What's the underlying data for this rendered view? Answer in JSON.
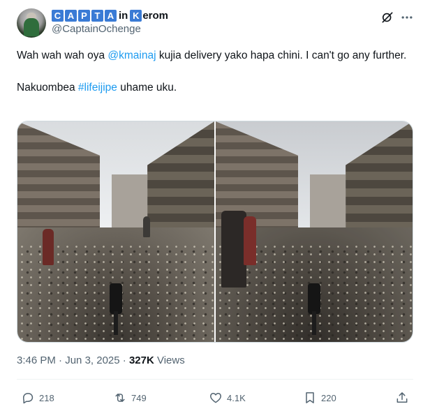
{
  "author": {
    "name_boxed": [
      "C",
      "A",
      "P",
      "T",
      "A"
    ],
    "name_in": "in",
    "name_k": "K",
    "name_rest": "erom",
    "handle": "@CaptainOchenge"
  },
  "tweet": {
    "line1_pre": "Wah wah wah oya ",
    "mention": "@kmainaj",
    "line1_post": " kujia delivery yako hapa chini. I can't go any further.",
    "line2_pre": "Nakuombea ",
    "hashtag": "#lifeijipe",
    "line2_post": " uhame uku."
  },
  "meta": {
    "time": "3:46 PM",
    "sep1": " · ",
    "date": "Jun 3, 2025",
    "sep2": " · ",
    "views_count": "327K",
    "views_label": " Views"
  },
  "actions": {
    "replies": "218",
    "reposts": "749",
    "likes": "4.1K",
    "bookmarks": "220"
  },
  "icons": {
    "top": [
      "grok-icon",
      "more-icon"
    ],
    "actions": [
      "reply-icon",
      "repost-icon",
      "like-icon",
      "bookmark-icon",
      "share-icon"
    ]
  },
  "colors": {
    "accent": "#1d9bf0",
    "secondary_text": "#536471",
    "name_box": "#3a7bd5"
  }
}
